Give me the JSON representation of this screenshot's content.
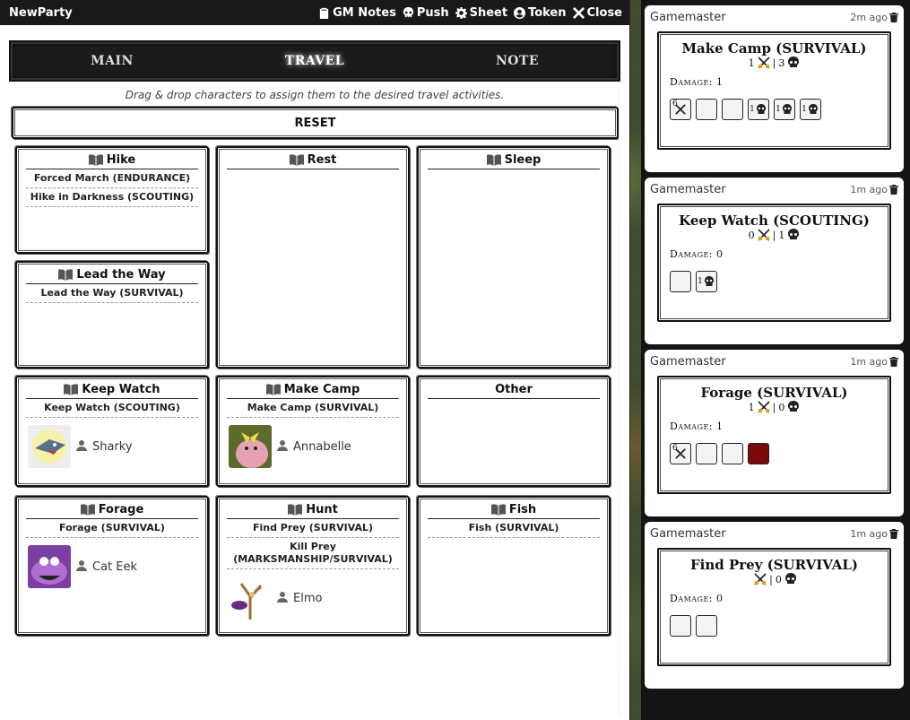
{
  "window": {
    "title": "NewParty",
    "actions": [
      {
        "label": "GM Notes",
        "icon": "clipboard-icon"
      },
      {
        "label": "Push",
        "icon": "skull-icon"
      },
      {
        "label": "Sheet",
        "icon": "gear-icon"
      },
      {
        "label": "Token",
        "icon": "user-circle-icon"
      },
      {
        "label": "Close",
        "icon": "close-icon"
      }
    ]
  },
  "tabs": [
    "MAIN",
    "TRAVEL",
    "NOTE"
  ],
  "active_tab": "TRAVEL",
  "hint": "Drag & drop characters to assign them to the desired travel activities.",
  "reset_label": "RESET",
  "activities": {
    "hike": {
      "title": "Hike",
      "skills": [
        "Forced March (ENDURANCE)",
        "Hike in Darkness (SCOUTING)"
      ]
    },
    "rest": {
      "title": "Rest"
    },
    "sleep": {
      "title": "Sleep"
    },
    "lead": {
      "title": "Lead the Way",
      "skills": [
        "Lead the Way (SURVIVAL)"
      ]
    },
    "keepwatch": {
      "title": "Keep Watch",
      "skills": [
        "Keep Watch (SCOUTING)"
      ],
      "character": "Sharky"
    },
    "makecamp": {
      "title": "Make Camp",
      "skills": [
        "Make Camp (SURVIVAL)"
      ],
      "character": "Annabelle"
    },
    "other": {
      "title": "Other"
    },
    "forage": {
      "title": "Forage",
      "skills": [
        "Forage (SURVIVAL)"
      ],
      "character": "Cat Eek"
    },
    "hunt": {
      "title": "Hunt",
      "skills": [
        "Find Prey (SURVIVAL)",
        "Kill Prey (MARKSMANSHIP/SURVIVAL)"
      ],
      "character": "Elmo"
    },
    "fish": {
      "title": "Fish",
      "skills": [
        "Fish (SURVIVAL)"
      ]
    }
  },
  "chat": [
    {
      "author": "Gamemaster",
      "time": "2m ago",
      "title": "Make Camp (SURVIVAL)",
      "success": "1",
      "bane": "3",
      "damage_label": "Damage:",
      "damage": "1",
      "dice": [
        "6",
        "",
        "",
        "1",
        "1",
        "1"
      ]
    },
    {
      "author": "Gamemaster",
      "time": "1m ago",
      "title": "Keep Watch (SCOUTING)",
      "success": "0",
      "bane": "1",
      "damage_label": "Damage:",
      "damage": "0",
      "dice": [
        "",
        "1"
      ]
    },
    {
      "author": "Gamemaster",
      "time": "1m ago",
      "title": "Forage (SURVIVAL)",
      "success": "1",
      "bane": "0",
      "damage_label": "Damage:",
      "damage": "1",
      "dice": [
        "6",
        "",
        "",
        ""
      ]
    },
    {
      "author": "Gamemaster",
      "time": "1m ago",
      "title": "Find Prey (SURVIVAL)",
      "success": "",
      "bane": "0",
      "damage_label": "Damage:",
      "damage": "0",
      "dice": [
        "",
        ""
      ]
    }
  ],
  "colors": {
    "titlebar": "#191919",
    "red_die": "#7a0b0b"
  }
}
